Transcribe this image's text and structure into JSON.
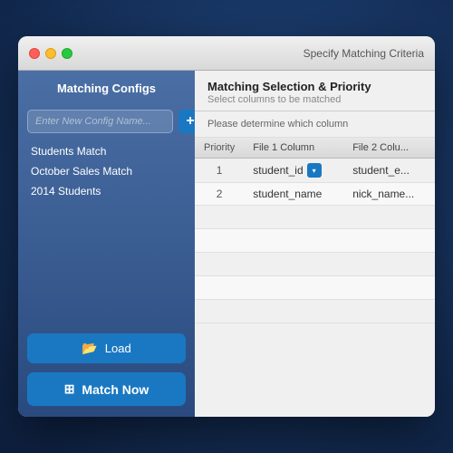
{
  "window": {
    "title": "Specify Matching Criteria"
  },
  "traffic_lights": {
    "red": "close",
    "yellow": "minimize",
    "green": "maximize"
  },
  "sidebar": {
    "title": "Matching Configs",
    "input_placeholder": "Enter New Config Name...",
    "add_button_label": "+",
    "configs": [
      {
        "name": "Students Match"
      },
      {
        "name": "October Sales Match"
      },
      {
        "name": "2014 Students"
      }
    ],
    "load_button": "Load",
    "match_now_button": "Match Now"
  },
  "main_panel": {
    "header": {
      "title": "Matching Selection & Priority",
      "subtitle": "Select columns to be matched"
    },
    "description": "Please determine which column",
    "table": {
      "columns": [
        "Priority",
        "File 1 Column",
        "File 2 Colu..."
      ],
      "rows": [
        {
          "priority": "1",
          "file1": "student_id",
          "file2": "student_e..."
        },
        {
          "priority": "2",
          "file1": "student_name",
          "file2": "nick_name..."
        }
      ],
      "empty_rows": 5
    }
  }
}
